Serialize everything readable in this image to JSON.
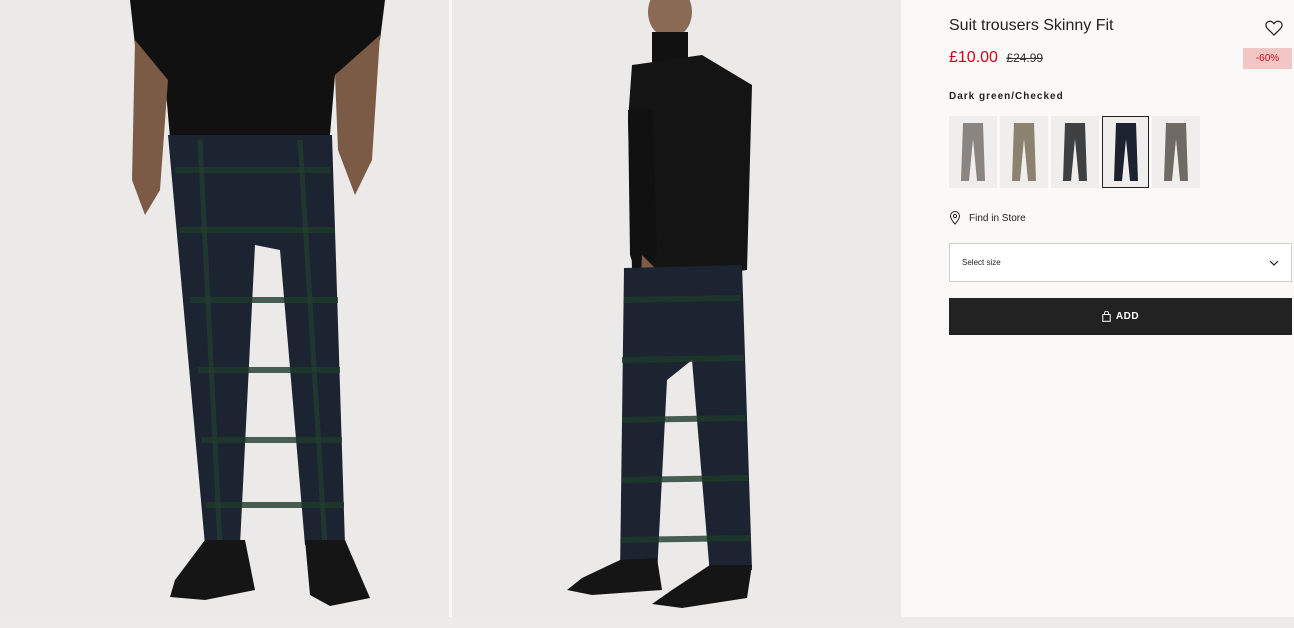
{
  "product": {
    "title": "Suit trousers Skinny Fit",
    "price_now": "£10.00",
    "price_was": "£24.99",
    "discount": "-60%",
    "colour_name": "Dark green/Checked"
  },
  "swatches": [
    {
      "colour": "#8a8580"
    },
    {
      "colour": "#8c8270"
    },
    {
      "colour": "#3f4042"
    },
    {
      "colour": "#1c2230",
      "selected": true
    },
    {
      "colour": "#6f6b63"
    }
  ],
  "actions": {
    "find_in_store": "Find in Store",
    "select_size_placeholder": "Select size",
    "add_label": "ADD"
  },
  "icons": [
    "heart-icon",
    "location-pin-icon",
    "chevron-down-icon",
    "bag-icon"
  ],
  "colors": {
    "sale_red": "#d0021b",
    "discount_bg": "#f2c6c4",
    "button_bg": "#222222"
  }
}
